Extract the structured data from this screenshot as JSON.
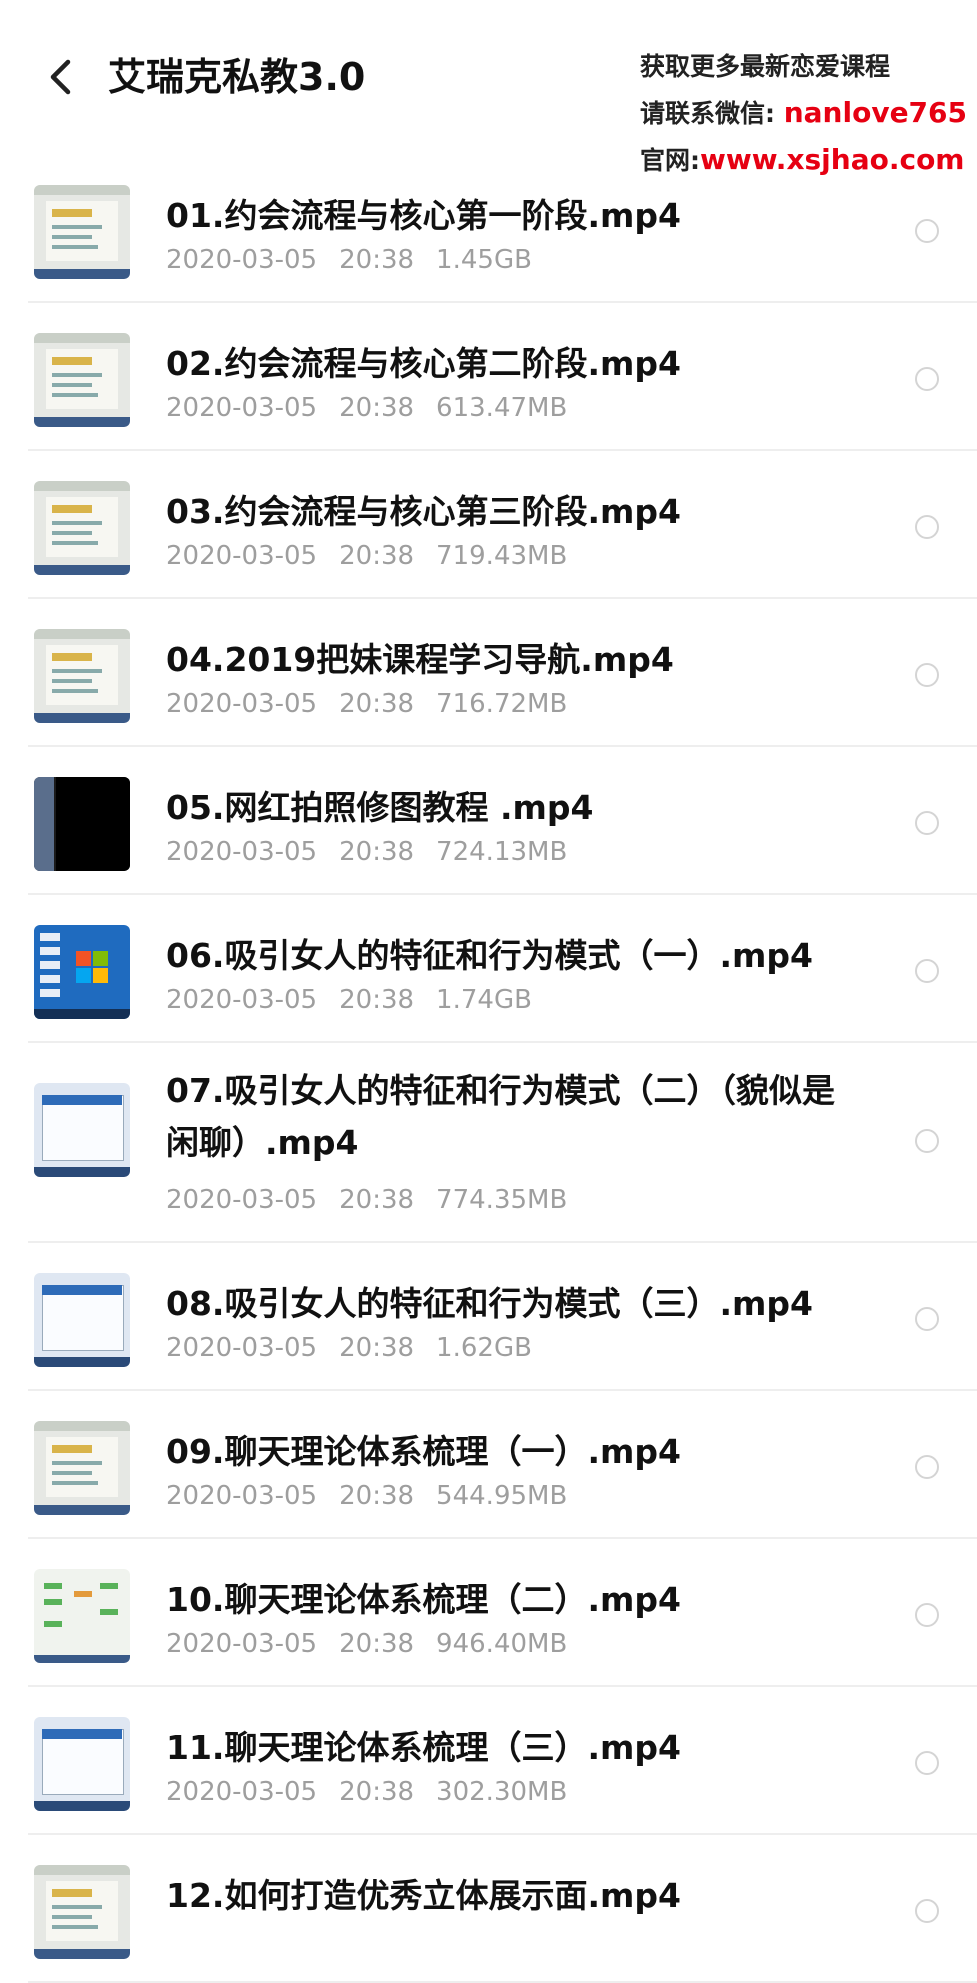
{
  "header": {
    "title": "艾瑞克私教3.0",
    "back_icon": "chevron-left-icon"
  },
  "promo": {
    "line1": "获取更多最新恋爱课程",
    "line2_label": "请联系微信:",
    "line2_value": "nanlove765",
    "line3_label": "官网:",
    "line3_value": "www.xsjhao.com",
    "accent_color": "#e60012"
  },
  "files": [
    {
      "name": "01.约会流程与核心第一阶段.mp4",
      "date": "2020-03-05",
      "time": "20:38",
      "size": "1.45GB",
      "thumb": "doc"
    },
    {
      "name": "02.约会流程与核心第二阶段.mp4",
      "date": "2020-03-05",
      "time": "20:38",
      "size": "613.47MB",
      "thumb": "doc"
    },
    {
      "name": "03.约会流程与核心第三阶段.mp4",
      "date": "2020-03-05",
      "time": "20:38",
      "size": "719.43MB",
      "thumb": "doc"
    },
    {
      "name": "04.2019把妹课程学习导航.mp4",
      "date": "2020-03-05",
      "time": "20:38",
      "size": "716.72MB",
      "thumb": "doc"
    },
    {
      "name": "05.网红拍照修图教程 .mp4",
      "date": "2020-03-05",
      "time": "20:38",
      "size": "724.13MB",
      "thumb": "dark"
    },
    {
      "name": "06.吸引女人的特征和行为模式（一）.mp4",
      "date": "2020-03-05",
      "time": "20:38",
      "size": "1.74GB",
      "thumb": "win"
    },
    {
      "name": "07.吸引女人的特征和行为模式（二）（貌似是闲聊）.mp4",
      "date": "2020-03-05",
      "time": "20:38",
      "size": "774.35MB",
      "thumb": "app",
      "tall": true
    },
    {
      "name": "08.吸引女人的特征和行为模式（三）.mp4",
      "date": "2020-03-05",
      "time": "20:38",
      "size": "1.62GB",
      "thumb": "app"
    },
    {
      "name": "09.聊天理论体系梳理（一）.mp4",
      "date": "2020-03-05",
      "time": "20:38",
      "size": "544.95MB",
      "thumb": "doc"
    },
    {
      "name": "10.聊天理论体系梳理（二）.mp4",
      "date": "2020-03-05",
      "time": "20:38",
      "size": "946.40MB",
      "thumb": "mind"
    },
    {
      "name": "11.聊天理论体系梳理（三）.mp4",
      "date": "2020-03-05",
      "time": "20:38",
      "size": "302.30MB",
      "thumb": "app"
    },
    {
      "name": "12.如何打造优秀立体展示面.mp4",
      "date": "",
      "time": "",
      "size": "",
      "thumb": "doc"
    }
  ]
}
